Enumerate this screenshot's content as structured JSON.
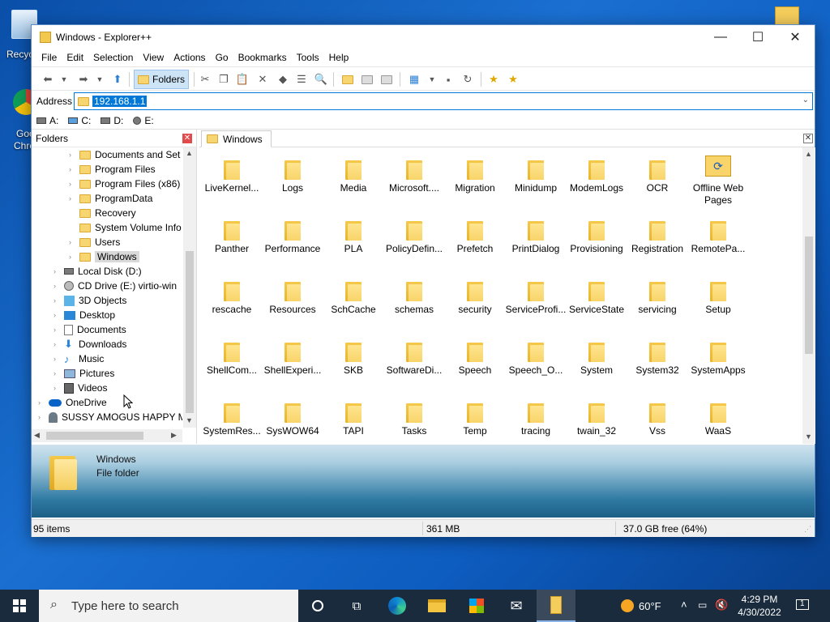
{
  "desktop": {
    "recycle_label": "Recyc",
    "chrome_label_1": "Goo",
    "chrome_label_2": "Chro"
  },
  "window": {
    "title": "Windows - Explorer++",
    "minimize": "—",
    "maximize": "☐",
    "close": "✕"
  },
  "menu": [
    "File",
    "Edit",
    "Selection",
    "View",
    "Actions",
    "Go",
    "Bookmarks",
    "Tools",
    "Help"
  ],
  "toolbar": {
    "folders_label": "Folders"
  },
  "address": {
    "label": "Address",
    "value": "192.168.1.1"
  },
  "drives": [
    "A:",
    "C:",
    "D:",
    "E:"
  ],
  "folder_pane": {
    "title": "Folders",
    "close": "✕",
    "tree": [
      {
        "label": "Documents and Set",
        "level": 2,
        "icon": "folder-shortcut"
      },
      {
        "label": "Program Files",
        "level": 2,
        "icon": "folder"
      },
      {
        "label": "Program Files (x86)",
        "level": 2,
        "icon": "folder"
      },
      {
        "label": "ProgramData",
        "level": 2,
        "icon": "folder"
      },
      {
        "label": "Recovery",
        "level": 2,
        "icon": "folder"
      },
      {
        "label": "System Volume Info",
        "level": 2,
        "icon": "folder"
      },
      {
        "label": "Users",
        "level": 2,
        "icon": "folder"
      },
      {
        "label": "Windows",
        "level": 2,
        "icon": "folder",
        "selected": true
      },
      {
        "label": "Local Disk (D:)",
        "level": 1,
        "icon": "drive"
      },
      {
        "label": "CD Drive (E:) virtio-win",
        "level": 1,
        "icon": "cd-drive"
      },
      {
        "label": "3D Objects",
        "level": 1,
        "icon": "3d-objects"
      },
      {
        "label": "Desktop",
        "level": 1,
        "icon": "desktop"
      },
      {
        "label": "Documents",
        "level": 1,
        "icon": "documents"
      },
      {
        "label": "Downloads",
        "level": 1,
        "icon": "downloads"
      },
      {
        "label": "Music",
        "level": 1,
        "icon": "music"
      },
      {
        "label": "Pictures",
        "level": 1,
        "icon": "pictures"
      },
      {
        "label": "Videos",
        "level": 1,
        "icon": "videos"
      },
      {
        "label": "OneDrive",
        "level": 0,
        "icon": "onedrive"
      },
      {
        "label": "SUSSY AMOGUS HAPPY M",
        "level": 0,
        "icon": "user"
      }
    ]
  },
  "tab": {
    "label": "Windows",
    "close": "✕"
  },
  "files": [
    [
      "LiveKernel...",
      "Logs",
      "Media",
      "Microsoft....",
      "Migration",
      "Minidump",
      "ModemLogs",
      "OCR",
      "Offline Web Pages"
    ],
    [
      "Panther",
      "Performance",
      "PLA",
      "PolicyDefin...",
      "Prefetch",
      "PrintDialog",
      "Provisioning",
      "Registration",
      "RemotePa..."
    ],
    [
      "rescache",
      "Resources",
      "SchCache",
      "schemas",
      "security",
      "ServiceProfi...",
      "ServiceState",
      "servicing",
      "Setup"
    ],
    [
      "ShellCom...",
      "ShellExperi...",
      "SKB",
      "SoftwareDi...",
      "Speech",
      "Speech_O...",
      "System",
      "System32",
      "SystemApps"
    ],
    [
      "SystemRes...",
      "SysWOW64",
      "TAPI",
      "Tasks",
      "Temp",
      "tracing",
      "twain_32",
      "Vss",
      "WaaS"
    ]
  ],
  "preview": {
    "name": "Windows",
    "type": "File folder"
  },
  "status": {
    "items": "95 items",
    "size": "361 MB",
    "free": "37.0 GB free (64%)"
  },
  "taskbar": {
    "search_placeholder": "Type here to search",
    "temperature": "60°F",
    "time": "4:29 PM",
    "date": "4/30/2022",
    "notifications": "1"
  }
}
